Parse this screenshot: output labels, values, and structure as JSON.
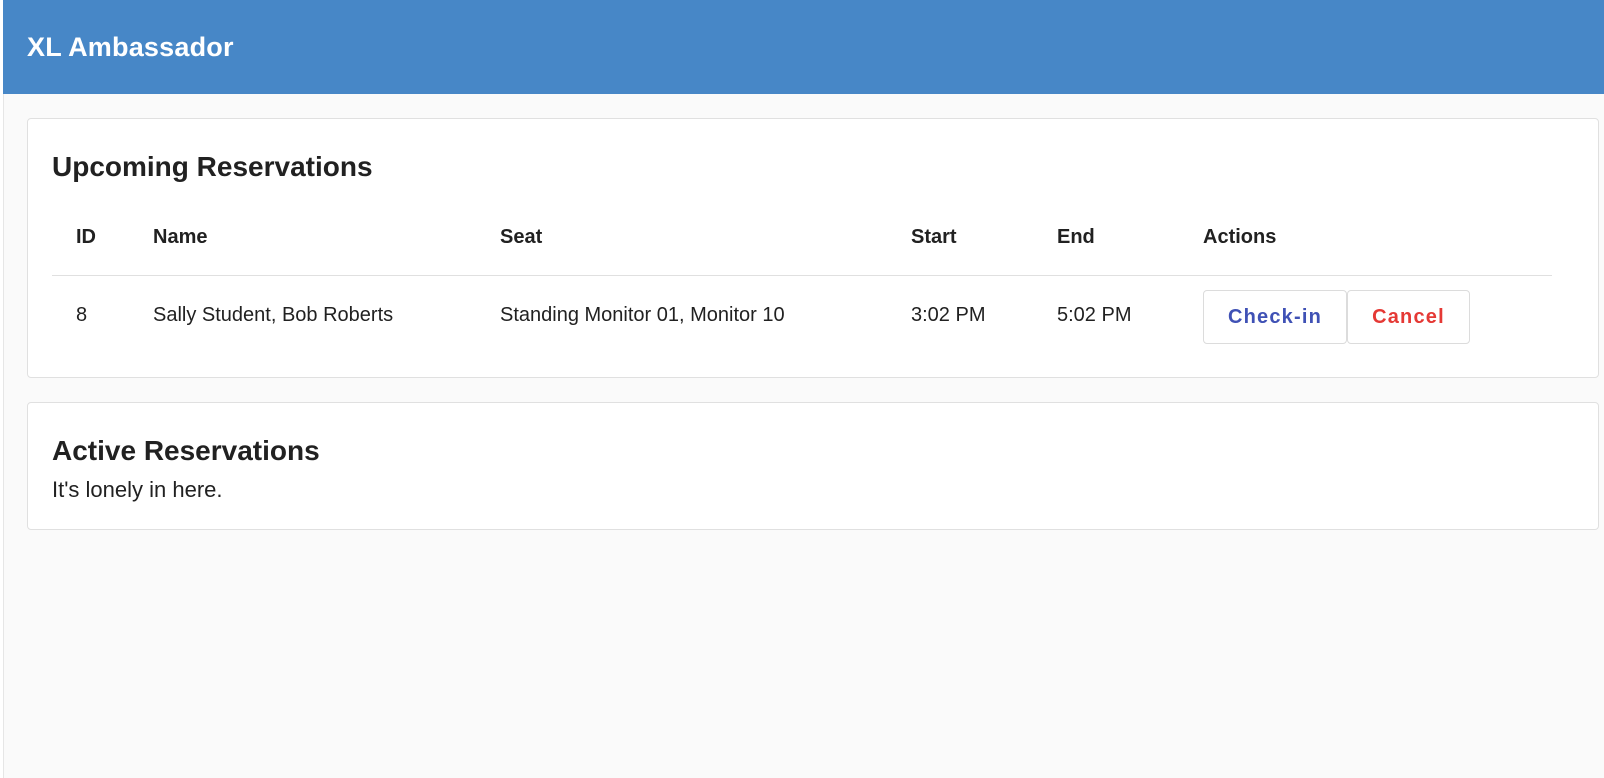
{
  "app": {
    "title": "XL Ambassador"
  },
  "upcoming": {
    "title": "Upcoming Reservations",
    "columns": {
      "id": "ID",
      "name": "Name",
      "seat": "Seat",
      "start": "Start",
      "end": "End",
      "actions": "Actions"
    },
    "rows": [
      {
        "id": "8",
        "name": "Sally Student, Bob Roberts",
        "seat": "Standing Monitor 01, Monitor 10",
        "start": "3:02 PM",
        "end": "5:02 PM",
        "checkin_label": "Check-in",
        "cancel_label": "Cancel"
      }
    ]
  },
  "active": {
    "title": "Active Reservations",
    "empty_message": "It's lonely in here."
  },
  "colors": {
    "app_bar": "#4787c7",
    "checkin": "#3f51b5",
    "cancel": "#e53935"
  }
}
